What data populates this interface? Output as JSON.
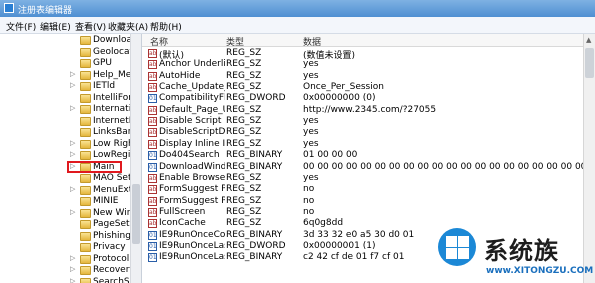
{
  "window": {
    "title": "注册表编辑器"
  },
  "menu": [
    "文件(F)",
    "编辑(E)",
    "查看(V)",
    "收藏夹(A)",
    "帮助(H)"
  ],
  "tree": [
    {
      "label": "Download",
      "arrow": ""
    },
    {
      "label": "Geolocatio",
      "arrow": ""
    },
    {
      "label": "GPU",
      "arrow": ""
    },
    {
      "label": "Help_Menu",
      "arrow": "▷"
    },
    {
      "label": "IETld",
      "arrow": "▷"
    },
    {
      "label": "IntelliForm",
      "arrow": ""
    },
    {
      "label": "Internation",
      "arrow": "▷"
    },
    {
      "label": "InternetReg",
      "arrow": ""
    },
    {
      "label": "LinksBar",
      "arrow": ""
    },
    {
      "label": "Low Rights",
      "arrow": "▷"
    },
    {
      "label": "LowRegistr",
      "arrow": "▷"
    },
    {
      "label": "Main",
      "arrow": "▷",
      "selected": true
    },
    {
      "label": "MAO Settin",
      "arrow": ""
    },
    {
      "label": "MenuExt",
      "arrow": "▷"
    },
    {
      "label": "MINIE",
      "arrow": ""
    },
    {
      "label": "New Windo",
      "arrow": "▷"
    },
    {
      "label": "PageSetup",
      "arrow": ""
    },
    {
      "label": "PhishingFil",
      "arrow": ""
    },
    {
      "label": "Privacy",
      "arrow": ""
    },
    {
      "label": "ProtocolEx",
      "arrow": "▷"
    },
    {
      "label": "Recovery",
      "arrow": "▷"
    },
    {
      "label": "SearchScor",
      "arrow": "▷"
    }
  ],
  "list": {
    "headers": {
      "name": "名称",
      "type": "类型",
      "data": "数据"
    },
    "rows": [
      {
        "icon": "string",
        "name": "(默认)",
        "type": "REG_SZ",
        "data": "(数值未设置)"
      },
      {
        "icon": "string",
        "name": "Anchor Underline",
        "type": "REG_SZ",
        "data": "yes"
      },
      {
        "icon": "string",
        "name": "AutoHide",
        "type": "REG_SZ",
        "data": "yes"
      },
      {
        "icon": "string",
        "name": "Cache_Update_F...",
        "type": "REG_SZ",
        "data": "Once_Per_Session"
      },
      {
        "icon": "binary",
        "name": "CompatibilityFla...",
        "type": "REG_DWORD",
        "data": "0x00000000 (0)"
      },
      {
        "icon": "string",
        "name": "Default_Page_URL",
        "type": "REG_SZ",
        "data": "http://www.2345.com/?27055"
      },
      {
        "icon": "string",
        "name": "Disable Script D...",
        "type": "REG_SZ",
        "data": "yes"
      },
      {
        "icon": "string",
        "name": "DisableScriptDe...",
        "type": "REG_SZ",
        "data": "yes"
      },
      {
        "icon": "string",
        "name": "Display Inline Im...",
        "type": "REG_SZ",
        "data": "yes"
      },
      {
        "icon": "binary",
        "name": "Do404Search",
        "type": "REG_BINARY",
        "data": "01 00 00 00"
      },
      {
        "icon": "binary",
        "name": "DownloadWind...",
        "type": "REG_BINARY",
        "data": "00 00 00 00 00 00 00 00 00 00 00 00 00 00 00 00 00 00 00 00 00 00 00 00 00"
      },
      {
        "icon": "string",
        "name": "Enable Browser ...",
        "type": "REG_SZ",
        "data": "yes"
      },
      {
        "icon": "string",
        "name": "FormSuggest Pa...",
        "type": "REG_SZ",
        "data": "no"
      },
      {
        "icon": "string",
        "name": "FormSuggest P...",
        "type": "REG_SZ",
        "data": "no"
      },
      {
        "icon": "string",
        "name": "FullScreen",
        "type": "REG_SZ",
        "data": "no"
      },
      {
        "icon": "string",
        "name": "IconCache",
        "type": "REG_SZ",
        "data": "6q0g8dd"
      },
      {
        "icon": "binary",
        "name": "IE9RunOnceCo...",
        "type": "REG_BINARY",
        "data": "3d 33 32 e0 a5 30 d0 01"
      },
      {
        "icon": "binary",
        "name": "IE9RunOnceLast...",
        "type": "REG_DWORD",
        "data": "0x00000001 (1)"
      },
      {
        "icon": "binary",
        "name": "IE9RunOnceLast...",
        "type": "REG_BINARY",
        "data": "c2 42 cf de 01 f7 cf 01"
      }
    ]
  },
  "watermark": {
    "name": "系统族",
    "url": "www.XITONGZU.COM"
  }
}
